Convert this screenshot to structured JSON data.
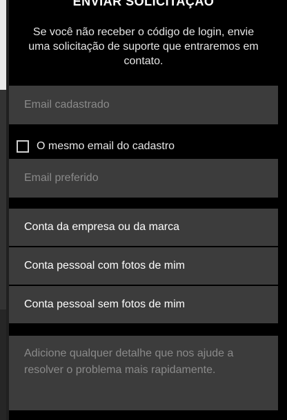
{
  "header": {
    "title": "ENVIAR SOLICITAÇÃO",
    "description": "Se você não receber o código de login, envie uma solicitação de suporte que entraremos em contato."
  },
  "form": {
    "registered_email_placeholder": "Email cadastrado",
    "same_email_label": "O mesmo email do cadastro",
    "same_email_checked": false,
    "preferred_email_placeholder": "Email preferido",
    "account_options": [
      "Conta da empresa ou da marca",
      "Conta pessoal com fotos de mim",
      "Conta pessoal sem fotos de mim"
    ],
    "details_placeholder": "Adicione qualquer detalhe que nos ajude a resolver o problema mais rapidamente."
  }
}
